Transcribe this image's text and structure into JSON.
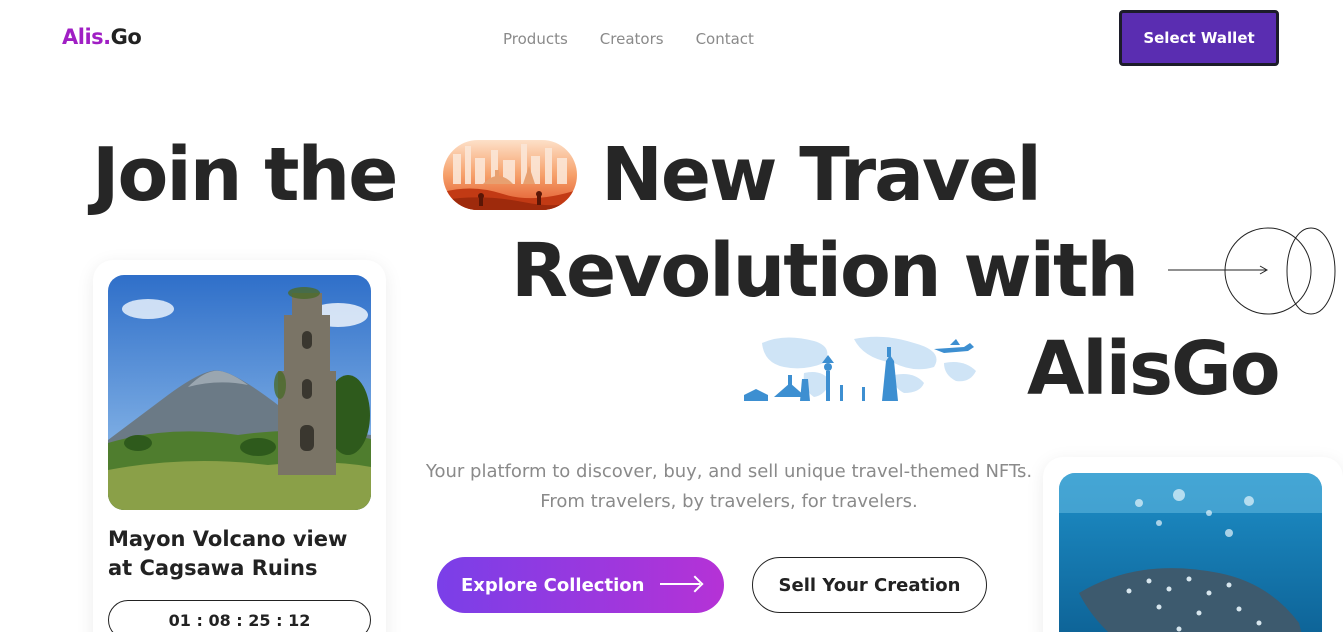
{
  "brand": {
    "logo_accent": "Alis.",
    "logo_rest": "Go",
    "accent_color": "#a01fc4"
  },
  "nav": {
    "items": [
      "Products",
      "Creators",
      "Contact"
    ]
  },
  "header": {
    "wallet_label": "Select Wallet",
    "wallet_color": "#5a2db1"
  },
  "hero": {
    "line1_part1": "Join the",
    "line1_part2": "New Travel",
    "line2": "Revolution with",
    "line3": "AlisGo",
    "subtitle_line1": "Your platform to discover, buy, and sell unique travel-themed NFTs.",
    "subtitle_line2": "From travelers, by travelers, for travelers.",
    "explore_label": "Explore Collection",
    "sell_label": "Sell Your Creation"
  },
  "cards": [
    {
      "title": "Mayon Volcano view at Cagsawa Ruins",
      "countdown": "01 : 08 : 25 : 12",
      "image": "volcano-ruins-photo"
    },
    {
      "image": "whale-shark-photo"
    }
  ],
  "colors": {
    "gradient_start": "#7a3fe8",
    "gradient_end": "#b532d6",
    "text_dark": "#262626",
    "text_muted": "#8a8a8a"
  }
}
